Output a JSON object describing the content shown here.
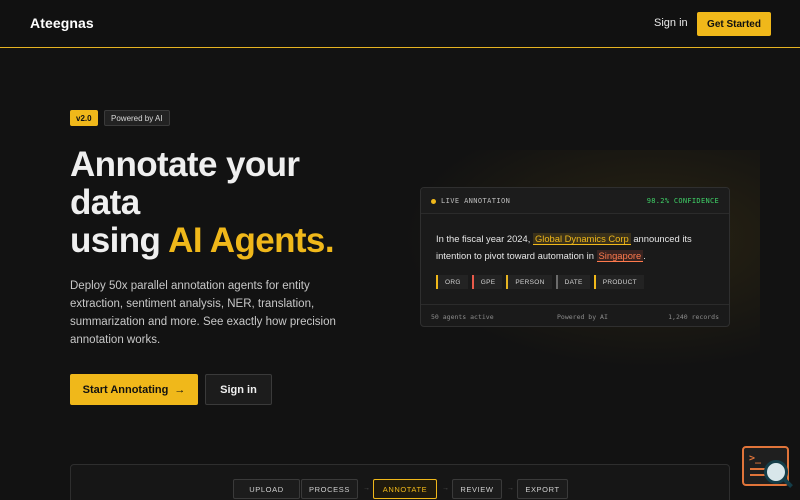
{
  "header": {
    "brand": "Ateegnas",
    "signin_label": "Sign in",
    "cta_label": "Get Started"
  },
  "badges": {
    "version": "v2.0",
    "powered": "Powered by AI"
  },
  "hero": {
    "title_line1": "Annotate your",
    "title_line2": "data",
    "title_line3_prefix": "using ",
    "title_line3_accent": "AI Agents",
    "title_line3_suffix": ".",
    "description": "Deploy 50x parallel annotation agents for entity extraction, sentiment analysis, NER, translation, summarization and more. See exactly how precision annotation works.",
    "primary_button": "Start Annotating",
    "primary_button_icon": "→",
    "secondary_button": "Sign in"
  },
  "card": {
    "live_label": "LIVE ANNOTATION",
    "confidence": "98.2% CONFIDENCE",
    "text_prefix": "In the fiscal year 2024, ",
    "entity_org": "Global Dynamics Corp",
    "text_middle": " announced its intention to pivot toward automation in ",
    "entity_gpe": "Singapore",
    "text_suffix": ".",
    "tags": [
      "ORG",
      "GPE",
      "PERSON",
      "DATE",
      "PRODUCT"
    ],
    "footer_left": "50 agents active",
    "footer_mid": "Powered by AI",
    "footer_right": "1,240 records"
  },
  "pipeline": {
    "steps": [
      "UPLOAD",
      "PROCESS",
      "ANNOTATE",
      "REVIEW",
      "EXPORT"
    ],
    "separator": "→",
    "active_step": "ANNOTATE"
  },
  "colors": {
    "accent": "#f0b81a",
    "background": "#121212",
    "confidence": "#3fd067",
    "gpe": "#ff7a4d"
  },
  "icons": {
    "arrow": "arrow-right-icon",
    "widget": "terminal-search-icon"
  }
}
